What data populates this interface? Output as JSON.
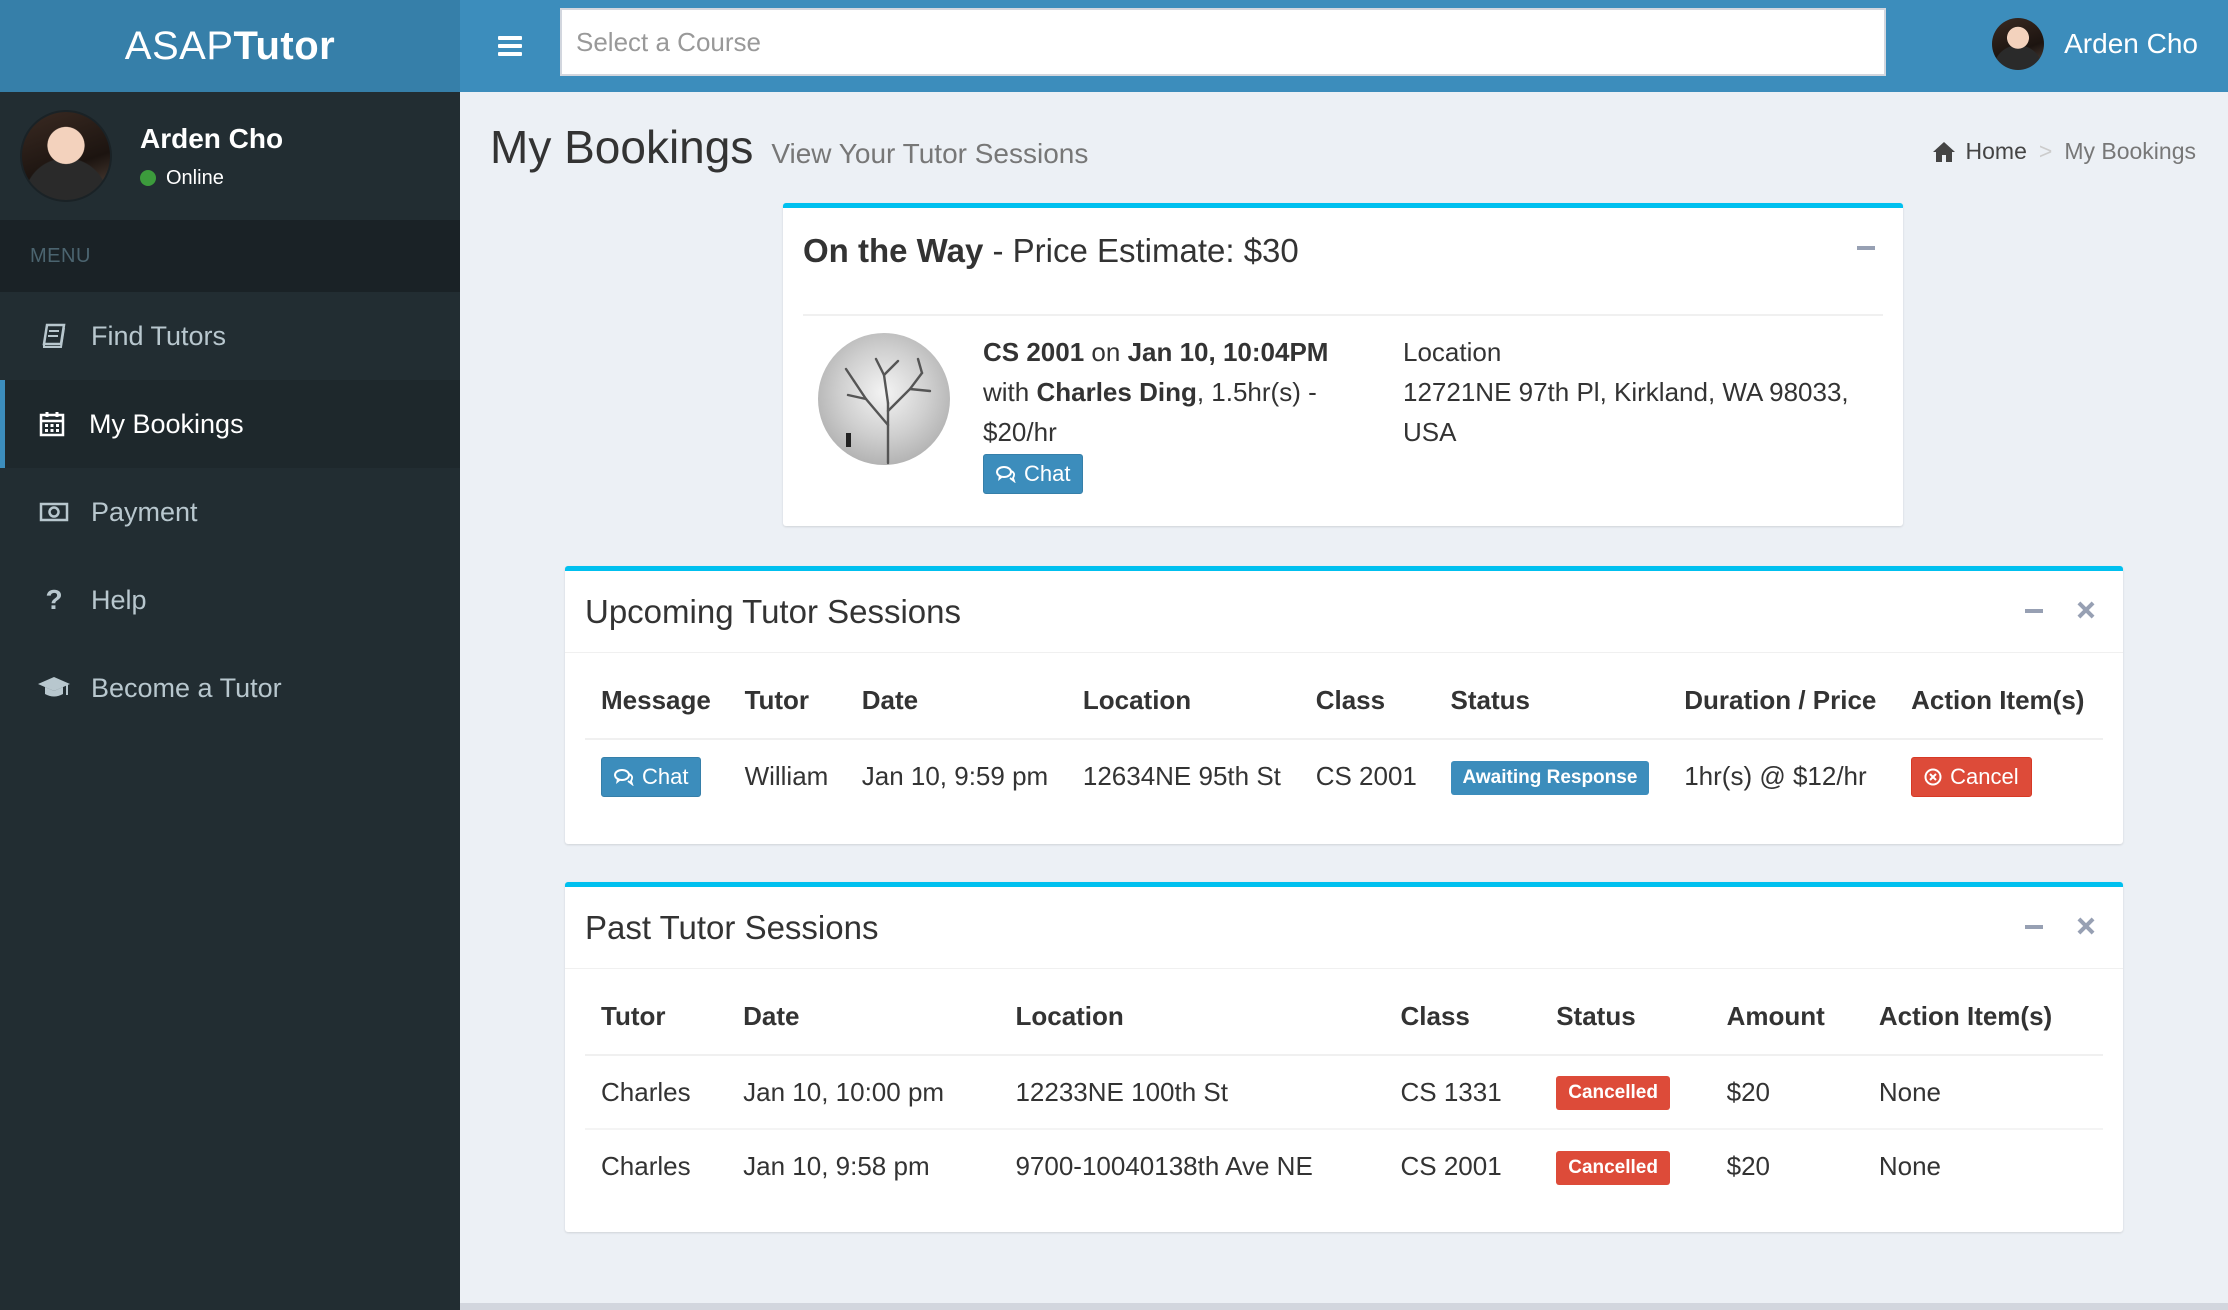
{
  "header": {
    "logo_light": "ASAP",
    "logo_bold": "Tutor",
    "search_placeholder": "Select a Course",
    "user_name": "Arden Cho"
  },
  "sidebar": {
    "user_name": "Arden Cho",
    "user_status": "Online",
    "menu_header": "MENU",
    "items": [
      {
        "label": "Find Tutors",
        "icon": "book-icon",
        "active": false
      },
      {
        "label": "My Bookings",
        "icon": "calendar-icon",
        "active": true
      },
      {
        "label": "Payment",
        "icon": "money-icon",
        "active": false
      },
      {
        "label": "Help",
        "icon": "question-icon",
        "active": false
      },
      {
        "label": "Become a Tutor",
        "icon": "graduation-cap-icon",
        "active": false
      }
    ]
  },
  "page": {
    "title": "My Bookings",
    "subtitle": "View Your Tutor Sessions",
    "breadcrumb_home": "Home",
    "breadcrumb_sep": ">",
    "breadcrumb_current": "My Bookings"
  },
  "on_the_way": {
    "title_bold": "On the Way",
    "title_rest": " - Price Estimate: $30",
    "course": "CS 2001",
    "on": " on ",
    "datetime": "Jan 10, 10:04PM",
    "with": "with ",
    "tutor": "Charles Ding",
    "rate": ", 1.5hr(s) - $20/hr",
    "chat_label": "Chat",
    "location_label": "Location",
    "location_address": "12721NE 97th Pl, Kirkland, WA 98033, USA"
  },
  "upcoming": {
    "title": "Upcoming Tutor Sessions",
    "columns": [
      "Message",
      "Tutor",
      "Date",
      "Location",
      "Class",
      "Status",
      "Duration / Price",
      "Action Item(s)"
    ],
    "rows": [
      {
        "message": "Chat",
        "tutor": "William",
        "date": "Jan 10, 9:59 pm",
        "location": "12634NE 95th St",
        "class": "CS 2001",
        "status": "Awaiting Response",
        "duration_price": "1hr(s) @ $12/hr",
        "action": "Cancel"
      }
    ]
  },
  "past": {
    "title": "Past Tutor Sessions",
    "columns": [
      "Tutor",
      "Date",
      "Location",
      "Class",
      "Status",
      "Amount",
      "Action Item(s)"
    ],
    "rows": [
      {
        "tutor": "Charles",
        "date": "Jan 10, 10:00 pm",
        "location": "12233NE 100th St",
        "class": "CS 1331",
        "status": "Cancelled",
        "amount": "$20",
        "action": "None"
      },
      {
        "tutor": "Charles",
        "date": "Jan 10, 9:58 pm",
        "location": "9700-10040138th Ave NE",
        "class": "CS 2001",
        "status": "Cancelled",
        "amount": "$20",
        "action": "None"
      }
    ]
  },
  "colors": {
    "header": "#3c8dbc",
    "logo_bg": "#367fa9",
    "sidebar": "#222d32",
    "box_top": "#00c0ef",
    "primary": "#3c8dbc",
    "danger": "#dd4b39",
    "online": "#3c9b3c"
  }
}
